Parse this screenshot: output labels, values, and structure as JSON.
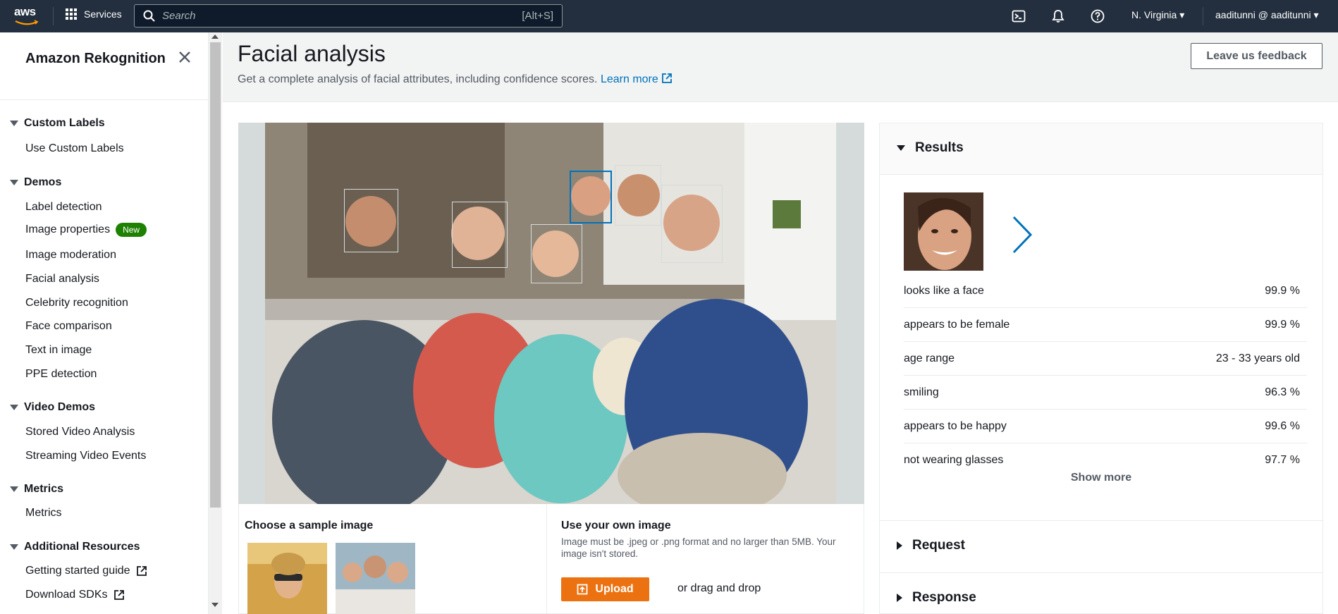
{
  "nav": {
    "logo": "aws",
    "services_label": "Services",
    "search_placeholder": "Search",
    "search_shortcut": "[Alt+S]",
    "region": "N. Virginia",
    "account": "aaditunni @ aaditunni"
  },
  "sidebar": {
    "title": "Amazon Rekognition",
    "sections": [
      {
        "label": "Custom Labels",
        "items": [
          {
            "label": "Use Custom Labels"
          }
        ]
      },
      {
        "label": "Demos",
        "items": [
          {
            "label": "Label detection"
          },
          {
            "label": "Image properties",
            "badge": "New"
          },
          {
            "label": "Image moderation"
          },
          {
            "label": "Facial analysis"
          },
          {
            "label": "Celebrity recognition"
          },
          {
            "label": "Face comparison"
          },
          {
            "label": "Text in image"
          },
          {
            "label": "PPE detection"
          }
        ]
      },
      {
        "label": "Video Demos",
        "items": [
          {
            "label": "Stored Video Analysis"
          },
          {
            "label": "Streaming Video Events"
          }
        ]
      },
      {
        "label": "Metrics",
        "items": [
          {
            "label": "Metrics"
          }
        ]
      },
      {
        "label": "Additional Resources",
        "items": [
          {
            "label": "Getting started guide",
            "external": true
          },
          {
            "label": "Download SDKs",
            "external": true
          }
        ]
      }
    ]
  },
  "page": {
    "title": "Facial analysis",
    "description": "Get a complete analysis of facial attributes, including confidence scores.",
    "learn_more": "Learn more",
    "feedback_button": "Leave us feedback"
  },
  "sample": {
    "heading": "Choose a sample image",
    "own_heading": "Use your own image",
    "own_description": "Image must be .jpeg or .png format and no larger than 5MB. Your image isn't stored.",
    "upload_button": "Upload",
    "drag_text": "or drag and drop"
  },
  "results": {
    "heading": "Results",
    "attributes": [
      {
        "label": "looks like a face",
        "value": "99.9 %"
      },
      {
        "label": "appears to be female",
        "value": "99.9 %"
      },
      {
        "label": "age range",
        "value": "23 - 33 years old"
      },
      {
        "label": "smiling",
        "value": "96.3 %"
      },
      {
        "label": "appears to be happy",
        "value": "99.6 %"
      },
      {
        "label": "not wearing glasses",
        "value": "97.7 %"
      }
    ],
    "show_more": "Show more",
    "request_heading": "Request",
    "response_heading": "Response"
  },
  "colors": {
    "nav_bg": "#232f3e",
    "link": "#0073bb",
    "upload": "#ec7211",
    "badge": "#1d8102",
    "selected_box": "#0073bb"
  }
}
